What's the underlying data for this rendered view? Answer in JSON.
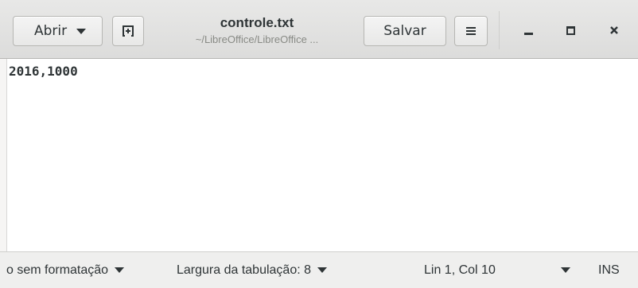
{
  "header": {
    "open_label": "Abrir",
    "new_tab_icon": "new-document-icon",
    "title": "controle.txt",
    "subtitle": "~/LibreOffice/LibreOffice ...",
    "save_label": "Salvar",
    "menu_icon": "hamburger-menu-icon",
    "window_controls": [
      "minimize-icon",
      "maximize-icon",
      "close-icon"
    ],
    "close_glyph": "×"
  },
  "editor": {
    "lines": [
      "2016,1000"
    ]
  },
  "statusbar": {
    "language": "o sem formatação",
    "tab_width": "Largura da tabulação: 8",
    "cursor_position": "Lin 1, Col 10",
    "insert_mode": "INS"
  }
}
